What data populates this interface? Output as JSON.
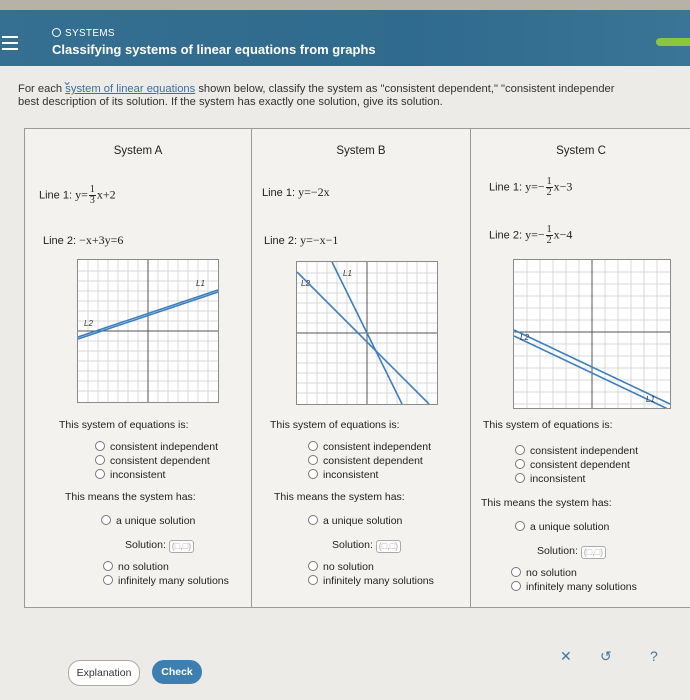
{
  "header": {
    "topic": "SYSTEMS",
    "title": "Classifying systems of linear equations from graphs"
  },
  "instructions": {
    "before": "For each ",
    "link": "system of linear equations",
    "after": " shown below, classify the system as \"consistent dependent,\" \"consistent independer",
    "line2": "best description of its solution. If the system has exactly one solution, give its solution."
  },
  "systems": [
    {
      "name": "System A",
      "line1_label": "Line 1:",
      "line1_eq_pre": "y=",
      "line1_frac_num": "1",
      "line1_frac_den": "3",
      "line1_eq_post": "x+2",
      "line2_label": "Line 2:",
      "line2_eq": "−x+3y=6",
      "graph_labels": [
        "L1",
        "L2"
      ],
      "classify_prompt": "This system of equations is:",
      "means_prompt": "This means the system has:",
      "solution_label": "Solution:"
    },
    {
      "name": "System B",
      "line1_label": "Line 1:",
      "line1_eq": "y=−2x",
      "line2_label": "Line 2:",
      "line2_eq": "y=−x−1",
      "graph_labels": [
        "L1",
        "L2"
      ],
      "classify_prompt": "This system of equations is:",
      "means_prompt": "This means the system has:",
      "solution_label": "Solution:"
    },
    {
      "name": "System C",
      "line1_label": "Line 1:",
      "line1_eq_pre": "y=−",
      "line1_frac_num": "1",
      "line1_frac_den": "2",
      "line1_eq_post": "x−3",
      "line2_label": "Line 2:",
      "line2_eq_pre": "y=−",
      "line2_frac_num": "1",
      "line2_frac_den": "2",
      "line2_eq_post": "x−4",
      "graph_labels": [
        "L1",
        "L2"
      ],
      "classify_prompt": "This system of equations is:",
      "means_prompt": "This means the system has:",
      "solution_label": "Solution:"
    }
  ],
  "options": {
    "classify": [
      "consistent independent",
      "consistent dependent",
      "inconsistent"
    ],
    "unique": "a unique solution",
    "none": "no solution",
    "infinite": "infinitely many solutions",
    "solution_box": "(□,□)"
  },
  "buttons": {
    "explanation": "Explanation",
    "check": "Check"
  },
  "footer_icons": [
    "close-icon",
    "undo-icon",
    "help-icon"
  ],
  "colors": {
    "header": "#2f6b8e",
    "line": "#3b7fc0",
    "check": "#3d7fb1",
    "accent_green": "#8cc63f"
  }
}
